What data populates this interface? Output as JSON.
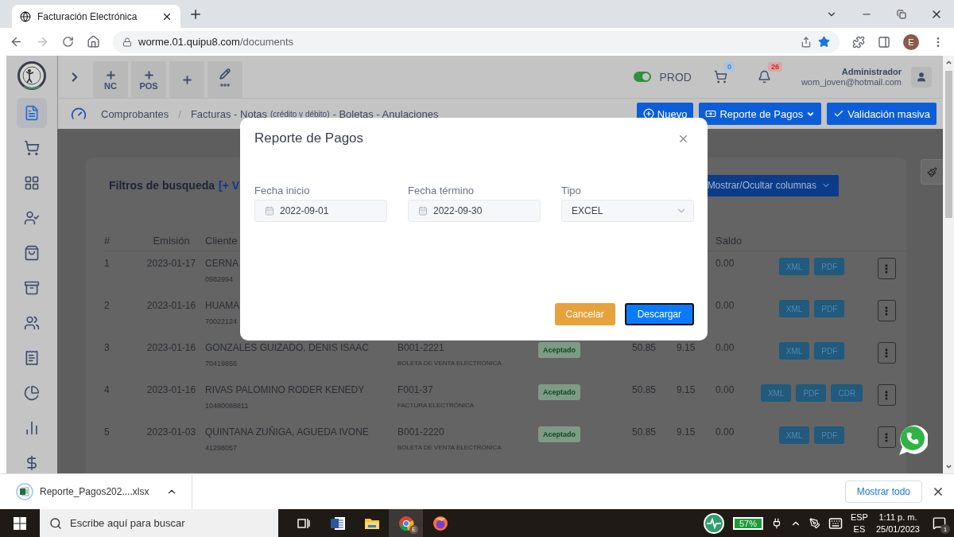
{
  "browser": {
    "tab": {
      "title": "Facturación Electrónica",
      "selected": true
    },
    "url_host": "worme.01.quipu8.com",
    "url_path": "/documents",
    "forward_disabled": true,
    "profile": "E"
  },
  "header": {
    "quick_buttons": [
      {
        "kind": "plus",
        "label": "NC"
      },
      {
        "kind": "plus",
        "label": "POS"
      },
      {
        "kind": "plus"
      },
      {
        "kind": "edit"
      }
    ],
    "environment": {
      "label": "PROD",
      "on": true
    },
    "cart_count": "0",
    "notification_count": "26",
    "user": {
      "name": "Administrador",
      "email": "wom_joven@hotmail.com"
    }
  },
  "sidebar": {
    "items": [
      {
        "kind": "document",
        "selected": true
      },
      {
        "kind": "cart",
        "selected": false
      },
      {
        "kind": "grid",
        "selected": false
      },
      {
        "kind": "user-check",
        "selected": false
      },
      {
        "kind": "bag",
        "selected": false
      },
      {
        "kind": "archive",
        "selected": false
      },
      {
        "kind": "users",
        "selected": false
      },
      {
        "kind": "receipt",
        "selected": false
      },
      {
        "kind": "pie",
        "selected": false
      },
      {
        "kind": "bars",
        "selected": false
      },
      {
        "kind": "dollar",
        "selected": false
      }
    ]
  },
  "breadcrumb": {
    "root": "Comprobantes",
    "separator": "/",
    "title": "Facturas - Notas",
    "note": "(crédito y débito)",
    "rest": "- Boletas - Anulaciones"
  },
  "actions": [
    {
      "kind": "plus",
      "label": "Nuevo",
      "dropdown": false
    },
    {
      "kind": "money",
      "label": "Reporte de Pagos",
      "dropdown": true
    },
    {
      "kind": "check",
      "label": "Validación masiva",
      "dropdown": false
    }
  ],
  "filters": {
    "title": "Filtros de busqueda",
    "link": "[+ V",
    "columns_button": "Mostrar/Ocultar columnas"
  },
  "table": {
    "headers": {
      "number": "#",
      "date": "Emisión",
      "client": "Cliente",
      "balance": "Saldo"
    },
    "rows": [
      {
        "number": "1",
        "date": "2023-01-17",
        "client": "CERNA",
        "client_id": "0982994",
        "balance": "0.00",
        "files": [
          "XML",
          "PDF"
        ]
      },
      {
        "number": "2",
        "date": "2023-01-16",
        "client": "HUAMA",
        "client_id": "70022124",
        "balance": "0.00",
        "files": [
          "XML",
          "PDF"
        ]
      },
      {
        "number": "3",
        "date": "2023-01-16",
        "client": "GONZALES GUIZADO, DENIS ISAAC",
        "client_id": "70419856",
        "document": "B001-2221",
        "document_type": "BOLETA DE VENTA ELECTRÓNICA",
        "status": "Aceptado",
        "column_7": "50.85",
        "column_8": "9.15",
        "balance": "0.00",
        "files": [
          "XML",
          "PDF"
        ]
      },
      {
        "number": "4",
        "date": "2023-01-16",
        "client": "RIVAS PALOMINO RODER KENEDY",
        "client_id": "10480088811",
        "document": "F001-37",
        "document_type": "FACTURA ELECTRÓNICA",
        "status": "Aceptado",
        "column_7": "50.85",
        "column_8": "9.15",
        "balance": "0.00",
        "files": [
          "XML",
          "PDF",
          "CDR"
        ]
      },
      {
        "number": "5",
        "date": "2023-01-03",
        "client": "QUINTANA ZUÑIGA, AGUEDA IVONE",
        "client_id": "41298057",
        "document": "B001-2220",
        "document_type": "BOLETA DE VENTA ELECTRÓNICA",
        "status": "Aceptado",
        "column_7": "50.85",
        "column_8": "9.15",
        "balance": "0.00",
        "files": [
          "XML",
          "PDF"
        ]
      }
    ]
  },
  "modal": {
    "title": "Reporte de Pagos",
    "fields": [
      {
        "kind": "date",
        "label": "Fecha inicio",
        "value": "2022-09-01"
      },
      {
        "kind": "date",
        "label": "Fecha término",
        "value": "2022-09-30"
      },
      {
        "kind": "select",
        "label": "Tipo",
        "value": "EXCEL"
      }
    ],
    "buttons": [
      {
        "kind": "secondary",
        "label": "Cancelar"
      },
      {
        "kind": "primary",
        "label": "Descargar"
      }
    ]
  },
  "download_bar": {
    "file": "Reporte_Pagos202....xlsx",
    "show_all": "Mostrar todo"
  },
  "taskbar": {
    "search_placeholder": "Escribe aquí para buscar",
    "apps": [
      {
        "kind": "taskview",
        "selected": false
      },
      {
        "kind": "word",
        "selected": false
      },
      {
        "kind": "explorer",
        "selected": false
      },
      {
        "kind": "chrome",
        "selected": true,
        "badge": "E"
      },
      {
        "kind": "firefox",
        "selected": false
      }
    ],
    "battery": "57%",
    "language": "ESP",
    "layout": "ES",
    "time": "1:11 p. m.",
    "date": "25/01/2023",
    "notifications": "1"
  }
}
